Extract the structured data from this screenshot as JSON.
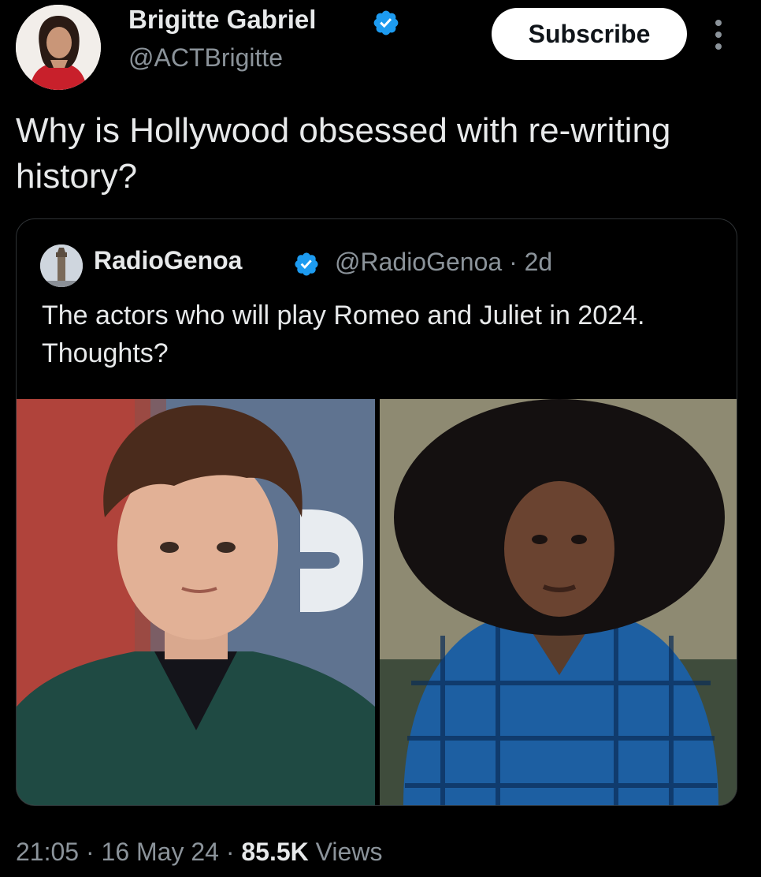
{
  "tweet": {
    "author": {
      "name": "Brigitte Gabriel",
      "handle": "@ACTBrigitte",
      "verified": true,
      "avatar_icon": "profile-photo"
    },
    "subscribe_label": "Subscribe",
    "more_icon": "vertical-ellipsis-icon",
    "text": "Why is Hollywood obsessed with re-writing history?",
    "quoted": {
      "author_name": "RadioGenoa",
      "verified": true,
      "meta": "@RadioGenoa · 2d",
      "text": "The actors who will play Romeo and Juliet in 2024. Thoughts?",
      "images": [
        {
          "icon": "photo-man-green-suit"
        },
        {
          "icon": "photo-woman-blue-plaid-shirt"
        }
      ]
    },
    "footer": {
      "time": "21:05",
      "separator": " · ",
      "date": "16 May 24",
      "views_count": "85.5K",
      "views_label": "Views"
    }
  },
  "colors": {
    "background": "#000000",
    "text_primary": "#e7e9ea",
    "text_secondary": "#8b939a",
    "verified_blue": "#1d9bf0",
    "button_bg": "#ffffff",
    "card_border": "#2f3336"
  }
}
